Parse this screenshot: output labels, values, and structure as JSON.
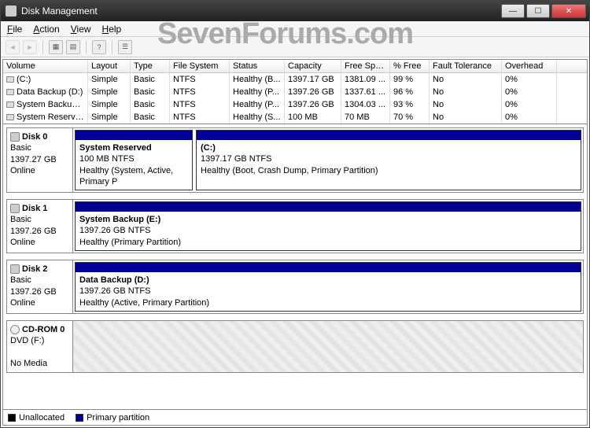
{
  "window": {
    "title": "Disk Management"
  },
  "menu": {
    "file": "File",
    "action": "Action",
    "view": "View",
    "help": "Help"
  },
  "watermark": "SevenForums.com",
  "columns": {
    "volume": "Volume",
    "layout": "Layout",
    "type": "Type",
    "fs": "File System",
    "status": "Status",
    "capacity": "Capacity",
    "freespace": "Free Spa...",
    "pctfree": "% Free",
    "fault": "Fault Tolerance",
    "overhead": "Overhead"
  },
  "volumes": [
    {
      "name": "(C:)",
      "layout": "Simple",
      "type": "Basic",
      "fs": "NTFS",
      "status": "Healthy (B...",
      "cap": "1397.17 GB",
      "free": "1381.09 ...",
      "pct": "99 %",
      "fault": "No",
      "oh": "0%"
    },
    {
      "name": "Data Backup (D:)",
      "layout": "Simple",
      "type": "Basic",
      "fs": "NTFS",
      "status": "Healthy (P...",
      "cap": "1397.26 GB",
      "free": "1337.61 ...",
      "pct": "96 %",
      "fault": "No",
      "oh": "0%"
    },
    {
      "name": "System Backup (E:)",
      "layout": "Simple",
      "type": "Basic",
      "fs": "NTFS",
      "status": "Healthy (P...",
      "cap": "1397.26 GB",
      "free": "1304.03 ...",
      "pct": "93 %",
      "fault": "No",
      "oh": "0%"
    },
    {
      "name": "System Reserved",
      "layout": "Simple",
      "type": "Basic",
      "fs": "NTFS",
      "status": "Healthy (S...",
      "cap": "100 MB",
      "free": "70 MB",
      "pct": "70 %",
      "fault": "No",
      "oh": "0%"
    }
  ],
  "disks": [
    {
      "name": "Disk 0",
      "type": "Basic",
      "size": "1397.27 GB",
      "state": "Online",
      "parts": [
        {
          "name": "System Reserved",
          "sub": "100 MB NTFS",
          "status": "Healthy (System, Active, Primary P",
          "small": true
        },
        {
          "name": " (C:)",
          "sub": "1397.17 GB NTFS",
          "status": "Healthy (Boot, Crash Dump, Primary Partition)"
        }
      ]
    },
    {
      "name": "Disk 1",
      "type": "Basic",
      "size": "1397.26 GB",
      "state": "Online",
      "parts": [
        {
          "name": "System Backup  (E:)",
          "sub": "1397.26 GB NTFS",
          "status": "Healthy (Primary Partition)"
        }
      ]
    },
    {
      "name": "Disk 2",
      "type": "Basic",
      "size": "1397.26 GB",
      "state": "Online",
      "parts": [
        {
          "name": "Data Backup  (D:)",
          "sub": "1397.26 GB NTFS",
          "status": "Healthy (Active, Primary Partition)"
        }
      ]
    },
    {
      "name": "CD-ROM 0",
      "type": "DVD (F:)",
      "size": "",
      "state": "No Media",
      "cd": true,
      "parts": []
    }
  ],
  "legend": {
    "unallocated": "Unallocated",
    "primary": "Primary partition"
  }
}
